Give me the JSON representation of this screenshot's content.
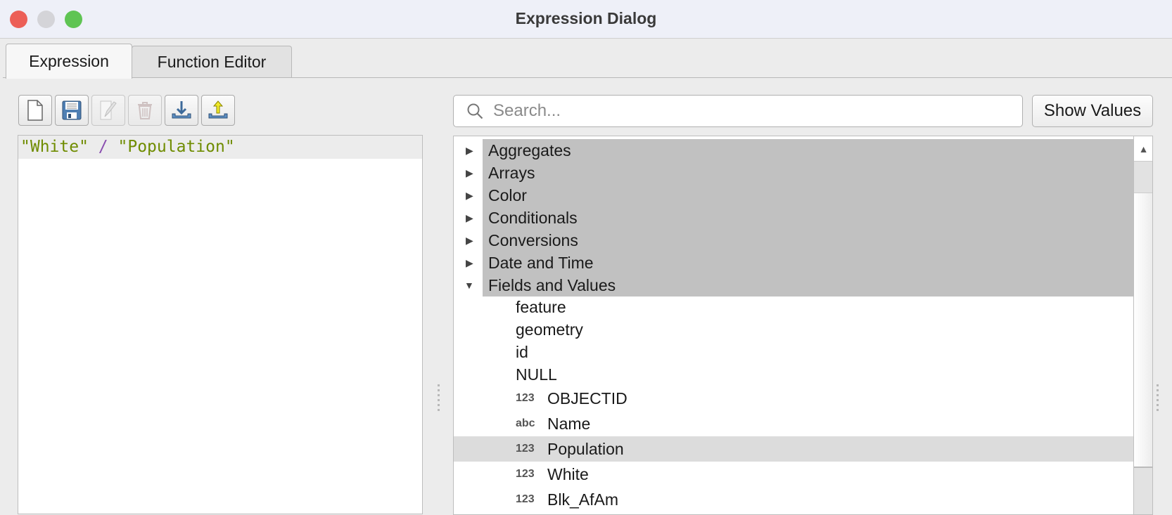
{
  "window": {
    "title": "Expression Dialog"
  },
  "tabs": [
    {
      "label": "Expression",
      "active": true
    },
    {
      "label": "Function Editor",
      "active": false
    }
  ],
  "toolbar": [
    {
      "icon": "new-file-icon",
      "enabled": true
    },
    {
      "icon": "save-icon",
      "enabled": true
    },
    {
      "icon": "edit-icon",
      "enabled": false
    },
    {
      "icon": "trash-icon",
      "enabled": false
    },
    {
      "icon": "import-icon",
      "enabled": true
    },
    {
      "icon": "export-icon",
      "enabled": true
    }
  ],
  "editor": {
    "field1": "\"White\"",
    "operator": "/",
    "field2": "\"Population\""
  },
  "search": {
    "placeholder": "Search...",
    "value": ""
  },
  "show_values_label": "Show Values",
  "tree": {
    "categories": [
      {
        "label": "Aggregates",
        "expanded": false
      },
      {
        "label": "Arrays",
        "expanded": false
      },
      {
        "label": "Color",
        "expanded": false
      },
      {
        "label": "Conditionals",
        "expanded": false
      },
      {
        "label": "Conversions",
        "expanded": false
      },
      {
        "label": "Date and Time",
        "expanded": false
      },
      {
        "label": "Fields and Values",
        "expanded": true
      }
    ],
    "fields": [
      {
        "label": "feature",
        "type": ""
      },
      {
        "label": "geometry",
        "type": ""
      },
      {
        "label": "id",
        "type": ""
      },
      {
        "label": "NULL",
        "type": ""
      },
      {
        "label": "OBJECTID",
        "type": "123"
      },
      {
        "label": "Name",
        "type": "abc"
      },
      {
        "label": "Population",
        "type": "123",
        "selected": true
      },
      {
        "label": "White",
        "type": "123"
      },
      {
        "label": "Blk_AfAm",
        "type": "123"
      }
    ]
  },
  "colors": {
    "string_literal": "#6f8c00",
    "operator": "#8a4fb0",
    "category_bg": "#c1c1c1",
    "selected_bg": "#dcdcdc"
  }
}
